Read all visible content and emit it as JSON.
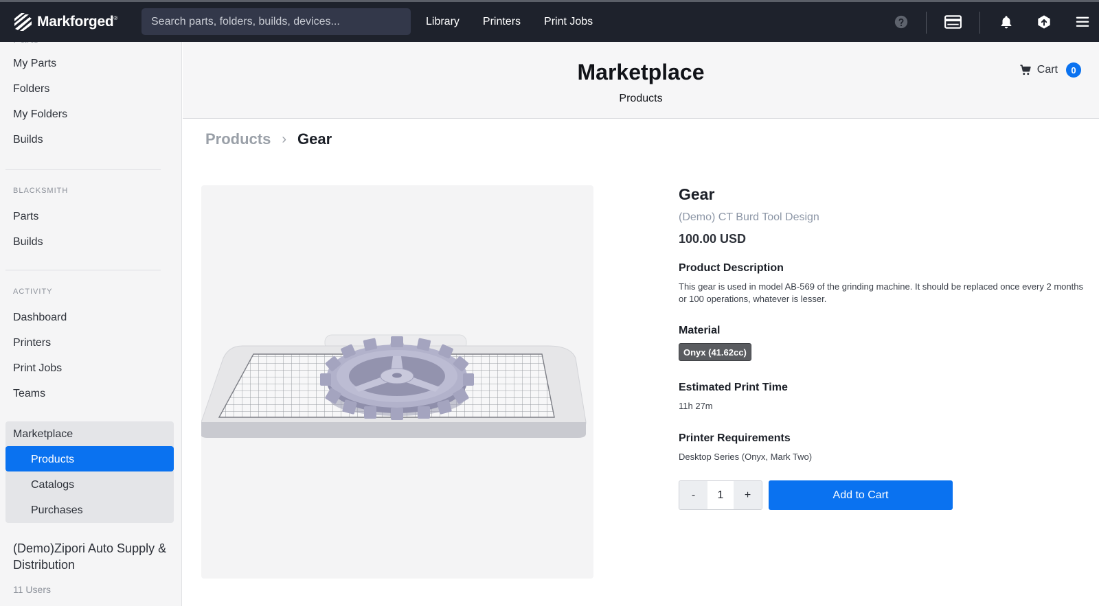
{
  "header": {
    "brand": "Markforged",
    "brand_mark": "®",
    "search_placeholder": "Search parts, folders, builds, devices...",
    "nav": [
      "Library",
      "Printers",
      "Print Jobs"
    ]
  },
  "sidebar": {
    "top_items": [
      "My Parts",
      "Folders",
      "My Folders",
      "Builds"
    ],
    "blacksmith": {
      "heading": "BLACKSMITH",
      "items": [
        "Parts",
        "Builds"
      ]
    },
    "activity": {
      "heading": "ACTIVITY",
      "items": [
        "Dashboard",
        "Printers",
        "Print Jobs",
        "Teams"
      ]
    },
    "marketplace": {
      "label": "Marketplace",
      "items": [
        "Products",
        "Catalogs",
        "Purchases"
      ],
      "active": "Products"
    },
    "org_name": "(Demo)Zipori Auto Supply & Distribution",
    "org_users": "11 Users"
  },
  "page": {
    "title": "Marketplace",
    "subtitle": "Products",
    "cart_label": "Cart",
    "cart_count": "0"
  },
  "breadcrumb": {
    "parent": "Products",
    "separator": "›",
    "current": "Gear"
  },
  "product": {
    "name": "Gear",
    "vendor": "(Demo) CT Burd Tool Design",
    "price": "100.00 USD",
    "description_label": "Product Description",
    "description": "This gear is used in model AB-569 of the grinding machine. It should be replaced once every 2 months or 100 operations, whatever is lesser.",
    "material_label": "Material",
    "material": "Onyx (41.62cc)",
    "print_time_label": "Estimated Print Time",
    "print_time": "11h 27m",
    "printer_req_label": "Printer Requirements",
    "printer_req": "Desktop Series (Onyx, Mark Two)"
  },
  "order": {
    "decrement": "-",
    "quantity": "1",
    "increment": "+",
    "add_label": "Add to Cart"
  },
  "colors": {
    "topbar": "#1e222c",
    "accent": "#0a72f0",
    "sidebar_bg": "#f5f5f6"
  },
  "icons": [
    "help-icon",
    "billing-card-icon",
    "bell-icon",
    "upload-icon",
    "menu-icon",
    "cart-icon"
  ]
}
